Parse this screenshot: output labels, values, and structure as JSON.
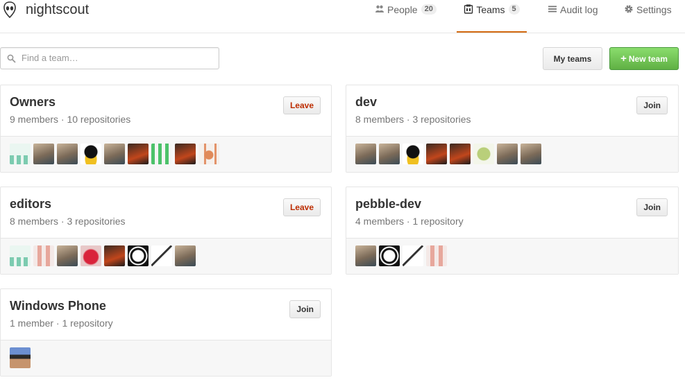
{
  "org": {
    "name": "nightscout"
  },
  "nav": [
    {
      "label": "People",
      "count": "20",
      "icon": "people-icon"
    },
    {
      "label": "Teams",
      "count": "5",
      "icon": "teams-icon",
      "selected": true
    },
    {
      "label": "Audit log",
      "icon": "list-icon"
    },
    {
      "label": "Settings",
      "icon": "gear-icon"
    }
  ],
  "search": {
    "placeholder": "Find a team…",
    "value": ""
  },
  "buttons": {
    "my_teams": "My teams",
    "new_team": "New team"
  },
  "colors": {
    "accent": "#d26911",
    "leave": "#bd2c00",
    "new_team": "#60b044"
  },
  "teams": [
    {
      "name": "Owners",
      "meta": "9 members · 10 repositories",
      "action": "Leave",
      "avatars": [
        "identicon-teal",
        "photo",
        "photo",
        "penguin",
        "photo",
        "photo-dark",
        "identicon-green",
        "photo-dark",
        "identicon-orange"
      ]
    },
    {
      "name": "dev",
      "meta": "8 members · 3 repositories",
      "action": "Join",
      "avatars": [
        "photo",
        "photo",
        "penguin",
        "photo-dark",
        "photo-dark",
        "identicon-olive",
        "photo",
        "photo"
      ]
    },
    {
      "name": "editors",
      "meta": "8 members · 3 repositories",
      "action": "Leave",
      "avatars": [
        "identicon-teal",
        "identicon-pink",
        "photo",
        "photo-red",
        "photo-dark",
        "logo-dragon",
        "bird",
        "photo"
      ]
    },
    {
      "name": "pebble-dev",
      "meta": "4 members · 1 repository",
      "action": "Join",
      "avatars": [
        "photo",
        "logo-dragon",
        "bird",
        "identicon-pink"
      ]
    },
    {
      "name": "Windows Phone",
      "meta": "1 member · 1 repository",
      "action": "Join",
      "avatars": [
        "photo-sunglasses"
      ]
    }
  ]
}
